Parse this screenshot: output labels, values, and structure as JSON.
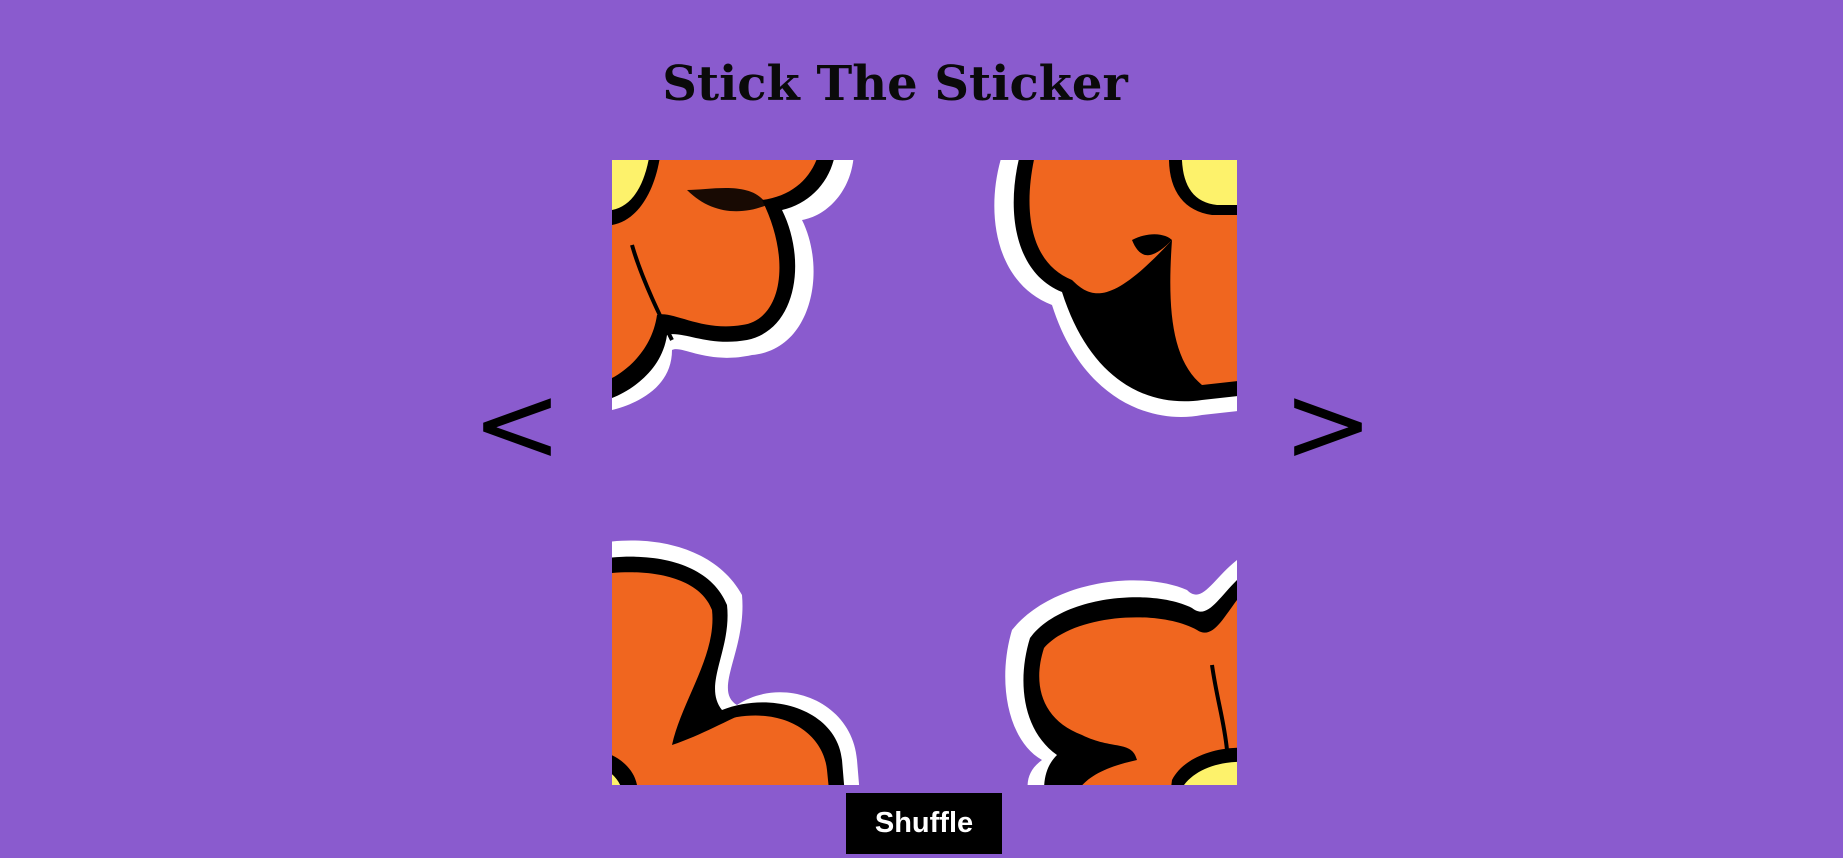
{
  "app": {
    "title": "Stick The Sticker"
  },
  "navigation": {
    "prev_label": "<",
    "next_label": ">"
  },
  "controls": {
    "shuffle_label": "Shuffle"
  },
  "colors": {
    "background": "#8a5bce",
    "petal": "#f0661f",
    "petal_outline": "#000000",
    "sticker_border": "#ffffff",
    "flower_center": "#fdf26b",
    "button_bg": "#000000",
    "button_text": "#ffffff"
  },
  "puzzle": {
    "tiles": [
      {
        "name": "top-left",
        "icon": "flower-petal-icon"
      },
      {
        "name": "top-right",
        "icon": "flower-petal-icon"
      },
      {
        "name": "bottom-left",
        "icon": "flower-petal-icon"
      },
      {
        "name": "bottom-right",
        "icon": "flower-petal-icon"
      }
    ]
  }
}
